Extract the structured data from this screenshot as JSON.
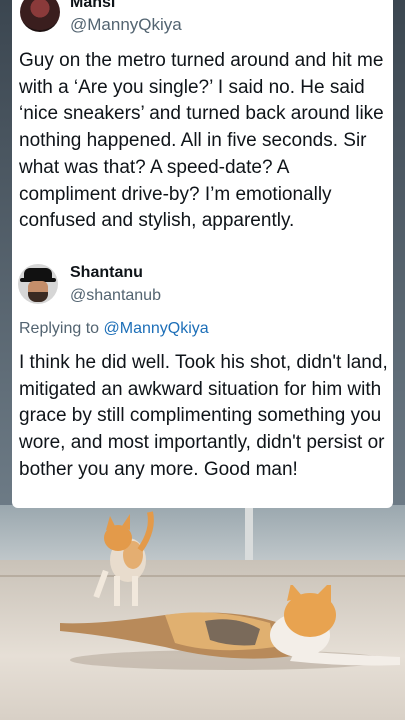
{
  "tweet": {
    "author_name": "Mansi",
    "author_handle": "@MannyQkiya",
    "text": "Guy on the metro turned around and hit me with a ‘Are you single?’ I said no. He said ‘nice sneakers’ and turned back around like nothing happened. All in five seconds. Sir what was that? A speed-date? A compliment drive-by? I’m emotionally confused and stylish, apparently."
  },
  "reply": {
    "author_name": "Shantanu",
    "author_handle": "@shantanub",
    "replying_to_label": "Replying to",
    "replying_to_handle": "@MannyQkiya",
    "text": "I think he did well. Took his shot, didn't land, mitigated an awkward situation for him with grace by still complimenting something you wore, and most importantly, didn't persist or bother you any more. Good man!"
  },
  "colors": {
    "text": "#0f1419",
    "secondary": "#536471",
    "mention": "#1d6fb8",
    "card_bg": "#ffffff"
  }
}
